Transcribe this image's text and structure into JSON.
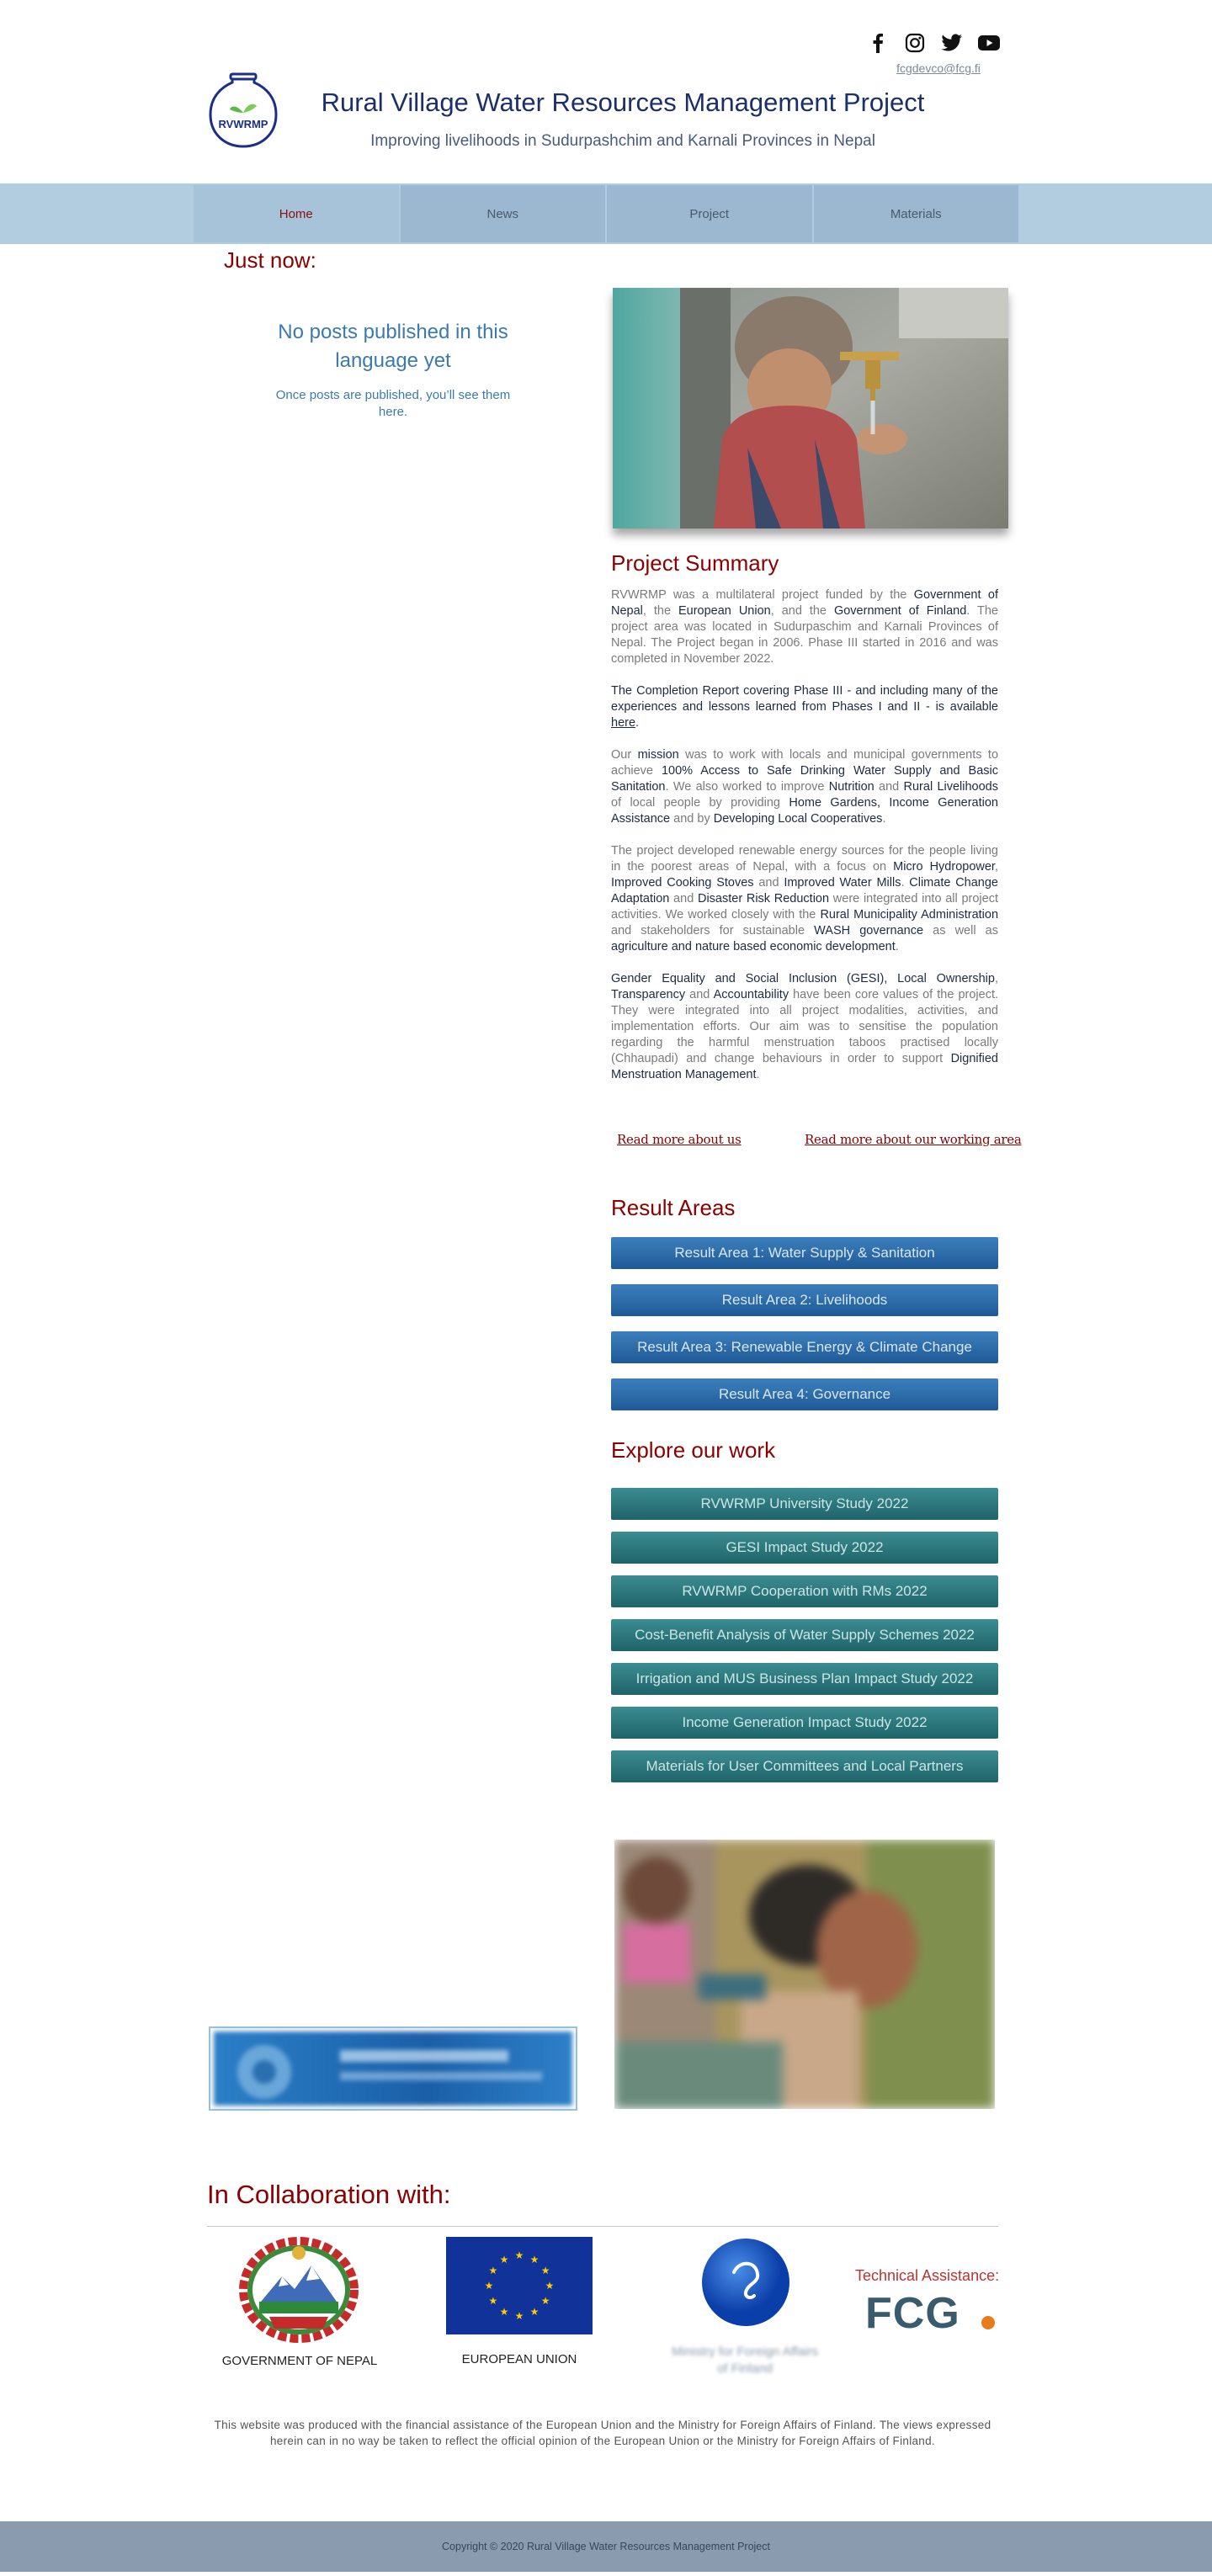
{
  "header": {
    "social": [
      "facebook-icon",
      "instagram-icon",
      "twitter-icon",
      "youtube-icon"
    ],
    "email": "fcgdevco@fcg.fi",
    "logo_text": "RVWRMP",
    "title": "Rural Village Water Resources Management Project",
    "tagline": "Improving livelihoods in Sudurpashchim and Karnali Provinces in Nepal"
  },
  "nav": {
    "items": [
      {
        "label": "Home",
        "active": true
      },
      {
        "label": "News"
      },
      {
        "label": "Project"
      },
      {
        "label": "Materials"
      }
    ]
  },
  "blog": {
    "heading": "Just now:",
    "empty_title": "No posts published in this language yet",
    "empty_sub": "Once posts are published, you’ll see them here."
  },
  "summary": {
    "title": "Project Summary",
    "p1": [
      "RVWRMP was a multilateral project funded by the ",
      "Government of Nepal",
      ", the ",
      "European Union",
      ", and the ",
      "Government of Finland",
      ". The project area was located in Sudurpaschim and Karnali Provinces of Nepal. The Project began in 2006. Phase III started in 2016 and was completed in November 2022."
    ],
    "p2": [
      "The Completion Report covering Phase III - and including many of the experiences and lessons learned from Phases I and II - is available ",
      "here",
      "."
    ],
    "p3": [
      "Our ",
      "mission",
      " was to work with locals and municipal governments to achieve ",
      "100% Access to Safe Drinking Water Supply and Basic Sanitation",
      ". We also worked to improve ",
      "Nutrition",
      " and ",
      "Rural Livelihoods",
      " of local people by providing ",
      "Home Gardens, Income Generation Assistance",
      " and by ",
      "Developing Local Cooperatives",
      "."
    ],
    "p4": [
      "The project developed renewable energy sources for the people living in the poorest areas of Nepal, with a focus on ",
      "Micro Hydropower",
      ", ",
      "Improved Cooking Stoves",
      " and ",
      "Improved Water Mills",
      ". ",
      "Climate Change Adaptation",
      " and ",
      "Disaster Risk Reduction",
      " were integrated into all project activities. We worked closely with the ",
      "Rural Municipality Administration",
      " and stakeholders for sustainable ",
      "WASH governance",
      " as well as ",
      "agriculture and nature based economic development",
      "."
    ],
    "p5": [
      "Gender Equality and Social Inclusion (GESI), Local Ownership",
      ", ",
      "Transparency",
      " and ",
      "Accountability",
      " have been core values of the project. They were integrated into all project modalities, activities, and implementation efforts. Our aim was to sensitise the population regarding the harmful menstruation taboos practised locally (Chhaupadi) and change behaviours in order to support ",
      "Dignified Menstruation Management",
      "."
    ],
    "read_more_us": "Read more about us",
    "read_more_area": "Read more about our working area"
  },
  "result_areas": {
    "title": "Result Areas",
    "buttons": [
      "Result Area 1: Water Supply & Sanitation",
      "Result Area 2: Livelihoods",
      "Result Area 3: Renewable Energy & Climate Change",
      "Result Area 4: Governance"
    ]
  },
  "explore": {
    "title": "Explore our work",
    "buttons": [
      "RVWRMP University Study 2022",
      "GESI Impact Study 2022",
      "RVWRMP Cooperation with RMs 2022",
      "Cost-Benefit Analysis of Water Supply Schemes 2022",
      "Irrigation and MUS Business Plan Impact Study 2022",
      "Income Generation Impact Study 2022",
      "Materials for User Committees and Local Partners"
    ]
  },
  "collaboration": {
    "title": "In Collaboration with:",
    "gov": "GOVERNMENT OF NEPAL",
    "eu": "EUROPEAN UNION",
    "mfa": "Ministry for Foreign Affairs of Finland",
    "ta_label": "Technical Assistance:",
    "fcg": "FCG"
  },
  "disclaimer": "This website was produced with the financial assistance of the European Union and the Ministry for Foreign Affairs of Finland. The views expressed herein can in no way be taken to reflect the official opinion of the European Union or the Ministry for Foreign Affairs of Finland.",
  "footer": "Copyright © 2020 Rural Village Water Resources Management Project",
  "colors": {
    "accent_red": "#8b0000",
    "nav_bg": "#b3cde0",
    "ra_blue": "#2a6ba8",
    "explore_teal": "#2c7a7f"
  }
}
